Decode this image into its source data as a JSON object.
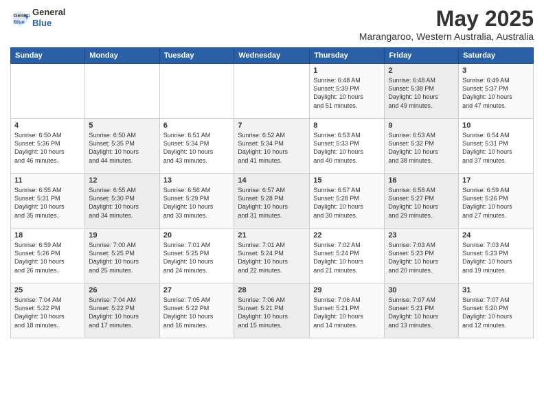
{
  "header": {
    "logo_line1": "General",
    "logo_line2": "Blue",
    "month": "May 2025",
    "location": "Marangaroo, Western Australia, Australia"
  },
  "days_of_week": [
    "Sunday",
    "Monday",
    "Tuesday",
    "Wednesday",
    "Thursday",
    "Friday",
    "Saturday"
  ],
  "weeks": [
    [
      {
        "day": "",
        "content": ""
      },
      {
        "day": "",
        "content": ""
      },
      {
        "day": "",
        "content": ""
      },
      {
        "day": "",
        "content": ""
      },
      {
        "day": "1",
        "content": "Sunrise: 6:48 AM\nSunset: 5:39 PM\nDaylight: 10 hours\nand 51 minutes."
      },
      {
        "day": "2",
        "content": "Sunrise: 6:48 AM\nSunset: 5:38 PM\nDaylight: 10 hours\nand 49 minutes."
      },
      {
        "day": "3",
        "content": "Sunrise: 6:49 AM\nSunset: 5:37 PM\nDaylight: 10 hours\nand 47 minutes."
      }
    ],
    [
      {
        "day": "4",
        "content": "Sunrise: 6:50 AM\nSunset: 5:36 PM\nDaylight: 10 hours\nand 46 minutes."
      },
      {
        "day": "5",
        "content": "Sunrise: 6:50 AM\nSunset: 5:35 PM\nDaylight: 10 hours\nand 44 minutes."
      },
      {
        "day": "6",
        "content": "Sunrise: 6:51 AM\nSunset: 5:34 PM\nDaylight: 10 hours\nand 43 minutes."
      },
      {
        "day": "7",
        "content": "Sunrise: 6:52 AM\nSunset: 5:34 PM\nDaylight: 10 hours\nand 41 minutes."
      },
      {
        "day": "8",
        "content": "Sunrise: 6:53 AM\nSunset: 5:33 PM\nDaylight: 10 hours\nand 40 minutes."
      },
      {
        "day": "9",
        "content": "Sunrise: 6:53 AM\nSunset: 5:32 PM\nDaylight: 10 hours\nand 38 minutes."
      },
      {
        "day": "10",
        "content": "Sunrise: 6:54 AM\nSunset: 5:31 PM\nDaylight: 10 hours\nand 37 minutes."
      }
    ],
    [
      {
        "day": "11",
        "content": "Sunrise: 6:55 AM\nSunset: 5:31 PM\nDaylight: 10 hours\nand 35 minutes."
      },
      {
        "day": "12",
        "content": "Sunrise: 6:55 AM\nSunset: 5:30 PM\nDaylight: 10 hours\nand 34 minutes."
      },
      {
        "day": "13",
        "content": "Sunrise: 6:56 AM\nSunset: 5:29 PM\nDaylight: 10 hours\nand 33 minutes."
      },
      {
        "day": "14",
        "content": "Sunrise: 6:57 AM\nSunset: 5:28 PM\nDaylight: 10 hours\nand 31 minutes."
      },
      {
        "day": "15",
        "content": "Sunrise: 6:57 AM\nSunset: 5:28 PM\nDaylight: 10 hours\nand 30 minutes."
      },
      {
        "day": "16",
        "content": "Sunrise: 6:58 AM\nSunset: 5:27 PM\nDaylight: 10 hours\nand 29 minutes."
      },
      {
        "day": "17",
        "content": "Sunrise: 6:59 AM\nSunset: 5:26 PM\nDaylight: 10 hours\nand 27 minutes."
      }
    ],
    [
      {
        "day": "18",
        "content": "Sunrise: 6:59 AM\nSunset: 5:26 PM\nDaylight: 10 hours\nand 26 minutes."
      },
      {
        "day": "19",
        "content": "Sunrise: 7:00 AM\nSunset: 5:25 PM\nDaylight: 10 hours\nand 25 minutes."
      },
      {
        "day": "20",
        "content": "Sunrise: 7:01 AM\nSunset: 5:25 PM\nDaylight: 10 hours\nand 24 minutes."
      },
      {
        "day": "21",
        "content": "Sunrise: 7:01 AM\nSunset: 5:24 PM\nDaylight: 10 hours\nand 22 minutes."
      },
      {
        "day": "22",
        "content": "Sunrise: 7:02 AM\nSunset: 5:24 PM\nDaylight: 10 hours\nand 21 minutes."
      },
      {
        "day": "23",
        "content": "Sunrise: 7:03 AM\nSunset: 5:23 PM\nDaylight: 10 hours\nand 20 minutes."
      },
      {
        "day": "24",
        "content": "Sunrise: 7:03 AM\nSunset: 5:23 PM\nDaylight: 10 hours\nand 19 minutes."
      }
    ],
    [
      {
        "day": "25",
        "content": "Sunrise: 7:04 AM\nSunset: 5:22 PM\nDaylight: 10 hours\nand 18 minutes."
      },
      {
        "day": "26",
        "content": "Sunrise: 7:04 AM\nSunset: 5:22 PM\nDaylight: 10 hours\nand 17 minutes."
      },
      {
        "day": "27",
        "content": "Sunrise: 7:05 AM\nSunset: 5:22 PM\nDaylight: 10 hours\nand 16 minutes."
      },
      {
        "day": "28",
        "content": "Sunrise: 7:06 AM\nSunset: 5:21 PM\nDaylight: 10 hours\nand 15 minutes."
      },
      {
        "day": "29",
        "content": "Sunrise: 7:06 AM\nSunset: 5:21 PM\nDaylight: 10 hours\nand 14 minutes."
      },
      {
        "day": "30",
        "content": "Sunrise: 7:07 AM\nSunset: 5:21 PM\nDaylight: 10 hours\nand 13 minutes."
      },
      {
        "day": "31",
        "content": "Sunrise: 7:07 AM\nSunset: 5:20 PM\nDaylight: 10 hours\nand 12 minutes."
      }
    ]
  ]
}
